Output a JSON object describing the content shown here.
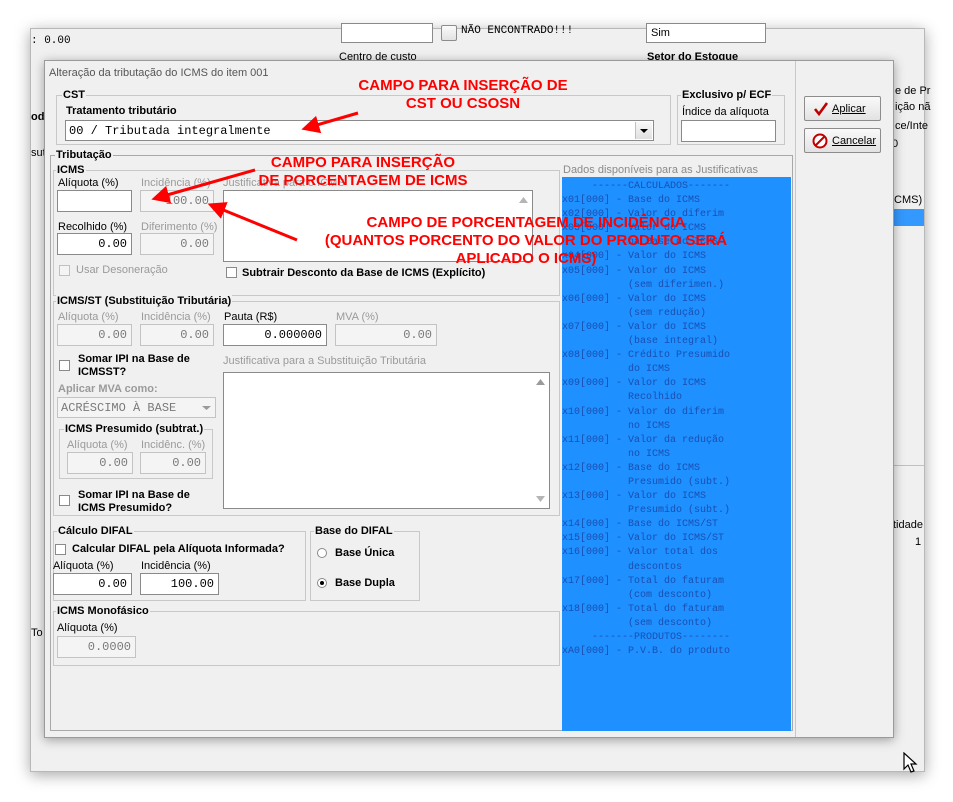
{
  "background": {
    "top_value": ": 0.00",
    "search_result": "NÃO ENCONTRADO!!!",
    "combo_value": "Sim",
    "centro_label": "Centro de custo",
    "setor_label": "Setor do Estoque",
    "right_fragments": [
      "e de Pr",
      "ição nã",
      "ce/Inte",
      "0",
      "ICMS)",
      "tidade",
      "1"
    ],
    "left_fragments": [
      "od",
      "sut",
      "To"
    ]
  },
  "dialog": {
    "title": "Alteração da tributação do ICMS do item 001",
    "apply_label": "Aplicar",
    "cancel_label": "Cancelar",
    "cst": {
      "group": "CST",
      "label": "Tratamento tributário",
      "value": "00 / Tributada integralmente"
    },
    "ecf": {
      "group": "Exclusivo p/ ECF",
      "label": "Índice da alíquota",
      "value": ""
    },
    "tributacao": {
      "group": "Tributação",
      "icms": {
        "group": "ICMS",
        "aliquota_label": "Alíquota (%)",
        "aliquota_value": "",
        "incidencia_label": "Incidência (%)",
        "incidencia_value": "100.00",
        "recolhido_label": "Recolhido (%)",
        "recolhido_value": "0.00",
        "diferimento_label": "Diferimento (%)",
        "diferimento_value": "0.00",
        "justificativa_label": "Justificativa para o ICMS",
        "usar_desoneracao": "Usar Desoneração",
        "subtrair_desconto": "Subtrair Desconto da Base de ICMS (Explícito)"
      },
      "icms_st": {
        "group": "ICMS/ST (Substituição Tributária)",
        "aliquota_label": "Alíquota (%)",
        "aliquota_value": "0.00",
        "incidencia_label": "Incidência (%)",
        "incidencia_value": "0.00",
        "pauta_label": "Pauta (R$)",
        "pauta_value": "0.000000",
        "mva_label": "MVA (%)",
        "mva_value": "0.00",
        "somar_ipi_icmsst": "Somar IPI na Base de ICMSST?",
        "justificativa_st_label": "Justificativa para a Substituição Tributária",
        "aplicar_mva_label": "Aplicar MVA como:",
        "aplicar_mva_value": "ACRÉSCIMO À BASE",
        "presumido": {
          "group": "ICMS Presumido (subtrat.)",
          "aliquota_label": "Alíquota (%)",
          "aliquota_value": "0.00",
          "incidencia_label": "Incidênc. (%)",
          "incidencia_value": "0.00"
        },
        "somar_ipi_presumido": "Somar IPI na Base de ICMS Presumido?"
      },
      "difal": {
        "group": "Cálculo DIFAL",
        "calcular_label": "Calcular DIFAL pela Alíquota Informada?",
        "aliquota_label": "Alíquota (%)",
        "aliquota_value": "0.00",
        "incidencia_label": "Incidência (%)",
        "incidencia_value": "100.00"
      },
      "base_difal": {
        "group": "Base do DIFAL",
        "unica": "Base Única",
        "dupla": "Base Dupla",
        "selected": "dupla"
      },
      "monofasico": {
        "group": "ICMS Monofásico",
        "aliquota_label": "Alíquota (%)",
        "aliquota_value": "0.0000"
      }
    },
    "dados": {
      "title": "Dados disponíveis para as Justificativas",
      "lines": [
        "     ------CALCULADOS-------",
        "x01[000] - Base do ICMS",
        "x02[000] - Valor do diferim",
        "x03[000] - Valor do ICMS",
        "           na Base do ICMS",
        "x04[000] - Valor do ICMS",
        "x05[000] - Valor do ICMS",
        "           (sem diferimen.)",
        "x06[000] - Valor do ICMS",
        "           (sem redução)",
        "x07[000] - Valor do ICMS",
        "           (base integral)",
        "x08[000] - Crédito Presumido",
        "           do ICMS",
        "x09[000] - Valor do ICMS",
        "           Recolhido",
        "x10[000] - Valor do diferim",
        "           no ICMS",
        "x11[000] - Valor da redução",
        "           no ICMS",
        "x12[000] - Base do ICMS",
        "           Presumido (subt.)",
        "x13[000] - Valor do ICMS",
        "           Presumido (subt.)",
        "x14[000] - Base do ICMS/ST",
        "x15[000] - Valor do ICMS/ST",
        "x16[000] - Valor total dos",
        "           descontos",
        "x17[000] - Total do faturam",
        "           (com desconto)",
        "x18[000] - Total do faturam",
        "           (sem desconto)",
        "",
        "     -------PRODUTOS--------",
        "xA0[000] - P.V.B. do produto"
      ]
    }
  },
  "annotations": {
    "cst_line1": "CAMPO PARA INSERÇÃO DE",
    "cst_line2": "CST OU CSOSN",
    "pct_line1": "CAMPO PARA INSERÇÃO",
    "pct_line2": "DE PORCENTAGEM DE ICMS",
    "inc_line1": "CAMPO DE PORCENTAGEM DE INCIDÊNCIA",
    "inc_line2": "(QUANTOS PORCENTO DO VALOR DO PRODUTO SERÁ",
    "inc_line3": "APLICADO O ICMS)"
  }
}
